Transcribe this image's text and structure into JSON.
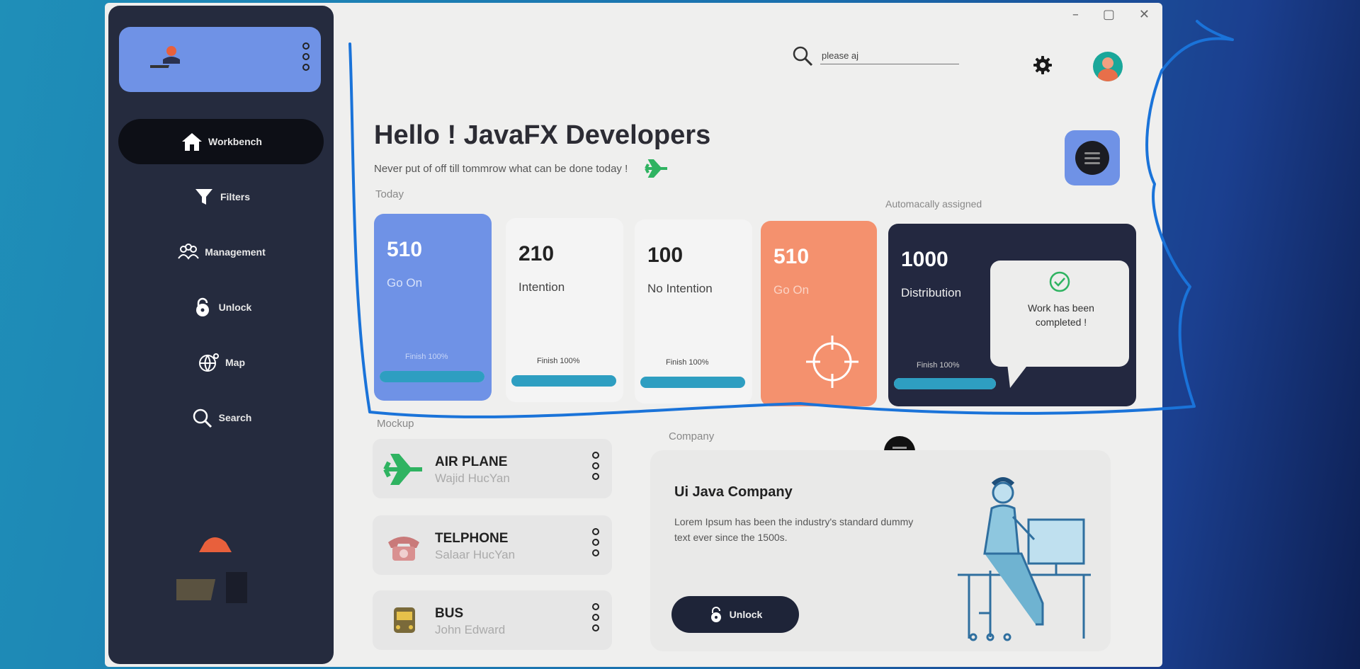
{
  "window": {
    "controls": [
      "–",
      "▢",
      "✕"
    ]
  },
  "sidebar": {
    "items": [
      {
        "label": "Workbench",
        "icon": "home-icon",
        "active": true
      },
      {
        "label": "Filters",
        "icon": "filter-icon"
      },
      {
        "label": "Management",
        "icon": "management-icon"
      },
      {
        "label": "Unlock",
        "icon": "unlock-icon"
      },
      {
        "label": "Map",
        "icon": "globe-icon"
      },
      {
        "label": "Search",
        "icon": "search-icon"
      }
    ]
  },
  "header": {
    "search_value": "please aj",
    "title": "Hello ! JavaFX Developers",
    "motto": "Never put of off till tommrow what can be done today !"
  },
  "today": {
    "label": "Today",
    "auto_label": "Automacally assigned",
    "cards": [
      {
        "value": "510",
        "label": "Go On",
        "finish": "Finish  100%",
        "progress": 1.0,
        "bg": "#6f92e6",
        "fg": "#ffffff"
      },
      {
        "value": "210",
        "label": "Intention",
        "finish": "Finish  100%",
        "progress": 1.0,
        "bg": "#f2f2f2",
        "fg": "#222222"
      },
      {
        "value": "100",
        "label": "No Intention",
        "finish": "Finish  100%",
        "progress": 1.0,
        "bg": "#f2f2f2",
        "fg": "#222222"
      },
      {
        "value": "510",
        "label": "Go On",
        "bg": "#f4916e",
        "fg": "#ffffff"
      },
      {
        "value": "1000",
        "label": "Distribution",
        "finish": "Finish  100%",
        "progress": 1.0,
        "bg": "#232840",
        "fg": "#ffffff"
      }
    ],
    "bubble_text": "Work has been completed !"
  },
  "mockup": {
    "label": "Mockup",
    "items": [
      {
        "title": "AIR PLANE",
        "subtitle": "Wajid HucYan",
        "icon": "airplane-icon"
      },
      {
        "title": "TELPHONE",
        "subtitle": "Salaar HucYan",
        "icon": "telephone-icon"
      },
      {
        "title": "BUS",
        "subtitle": "John Edward",
        "icon": "bus-icon"
      }
    ]
  },
  "company": {
    "label": "Company",
    "title": "Ui Java Company",
    "text": "Lorem Ipsum has been the industry's standard dummy text ever since the 1500s.",
    "button": "Unlock"
  }
}
